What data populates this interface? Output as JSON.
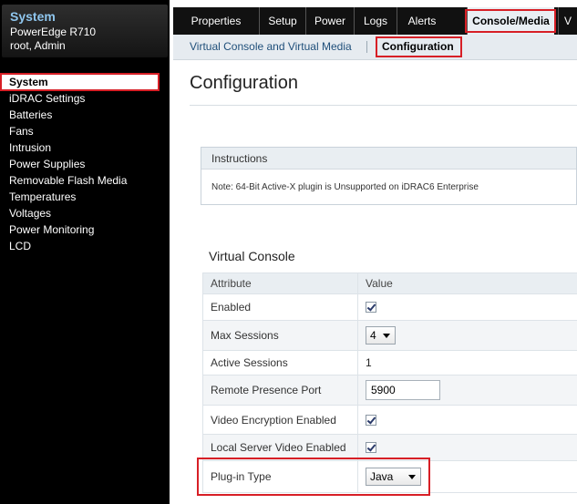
{
  "sidebar": {
    "title": "System",
    "model": "PowerEdge R710",
    "user": "root, Admin",
    "items": [
      {
        "label": "System"
      },
      {
        "label": "iDRAC Settings"
      },
      {
        "label": "Batteries"
      },
      {
        "label": "Fans"
      },
      {
        "label": "Intrusion"
      },
      {
        "label": "Power Supplies"
      },
      {
        "label": "Removable Flash Media"
      },
      {
        "label": "Temperatures"
      },
      {
        "label": "Voltages"
      },
      {
        "label": "Power Monitoring"
      },
      {
        "label": "LCD"
      }
    ],
    "selected": "System"
  },
  "tabs": [
    {
      "label": "Properties"
    },
    {
      "label": "Setup"
    },
    {
      "label": "Power"
    },
    {
      "label": "Logs"
    },
    {
      "label": "Alerts"
    },
    {
      "label": "Console/Media"
    },
    {
      "label": "V"
    }
  ],
  "active_tab": "Console/Media",
  "subtabs": [
    {
      "label": "Virtual Console and Virtual Media"
    },
    {
      "label": "Configuration"
    }
  ],
  "active_subtab": "Configuration",
  "page": {
    "title": "Configuration"
  },
  "instructions": {
    "heading": "Instructions",
    "note": "Note: 64-Bit Active-X plugin is Unsupported on iDRAC6 Enterprise"
  },
  "virtual_console": {
    "title": "Virtual Console",
    "headers": {
      "attribute": "Attribute",
      "value": "Value"
    },
    "rows": {
      "enabled": {
        "label": "Enabled",
        "checked": true
      },
      "max_sessions": {
        "label": "Max Sessions",
        "value": "4"
      },
      "active_sessions": {
        "label": "Active Sessions",
        "value": "1"
      },
      "remote_port": {
        "label": "Remote Presence Port",
        "value": "5900"
      },
      "video_encryption": {
        "label": "Video Encryption Enabled",
        "checked": true
      },
      "local_video": {
        "label": "Local Server Video Enabled",
        "checked": true
      },
      "plugin_type": {
        "label": "Plug-in Type",
        "value": "Java"
      }
    }
  },
  "colors": {
    "highlight": "#d71f26",
    "sidebar_title": "#8fc6ee",
    "tabbar_bg": "#111111"
  }
}
